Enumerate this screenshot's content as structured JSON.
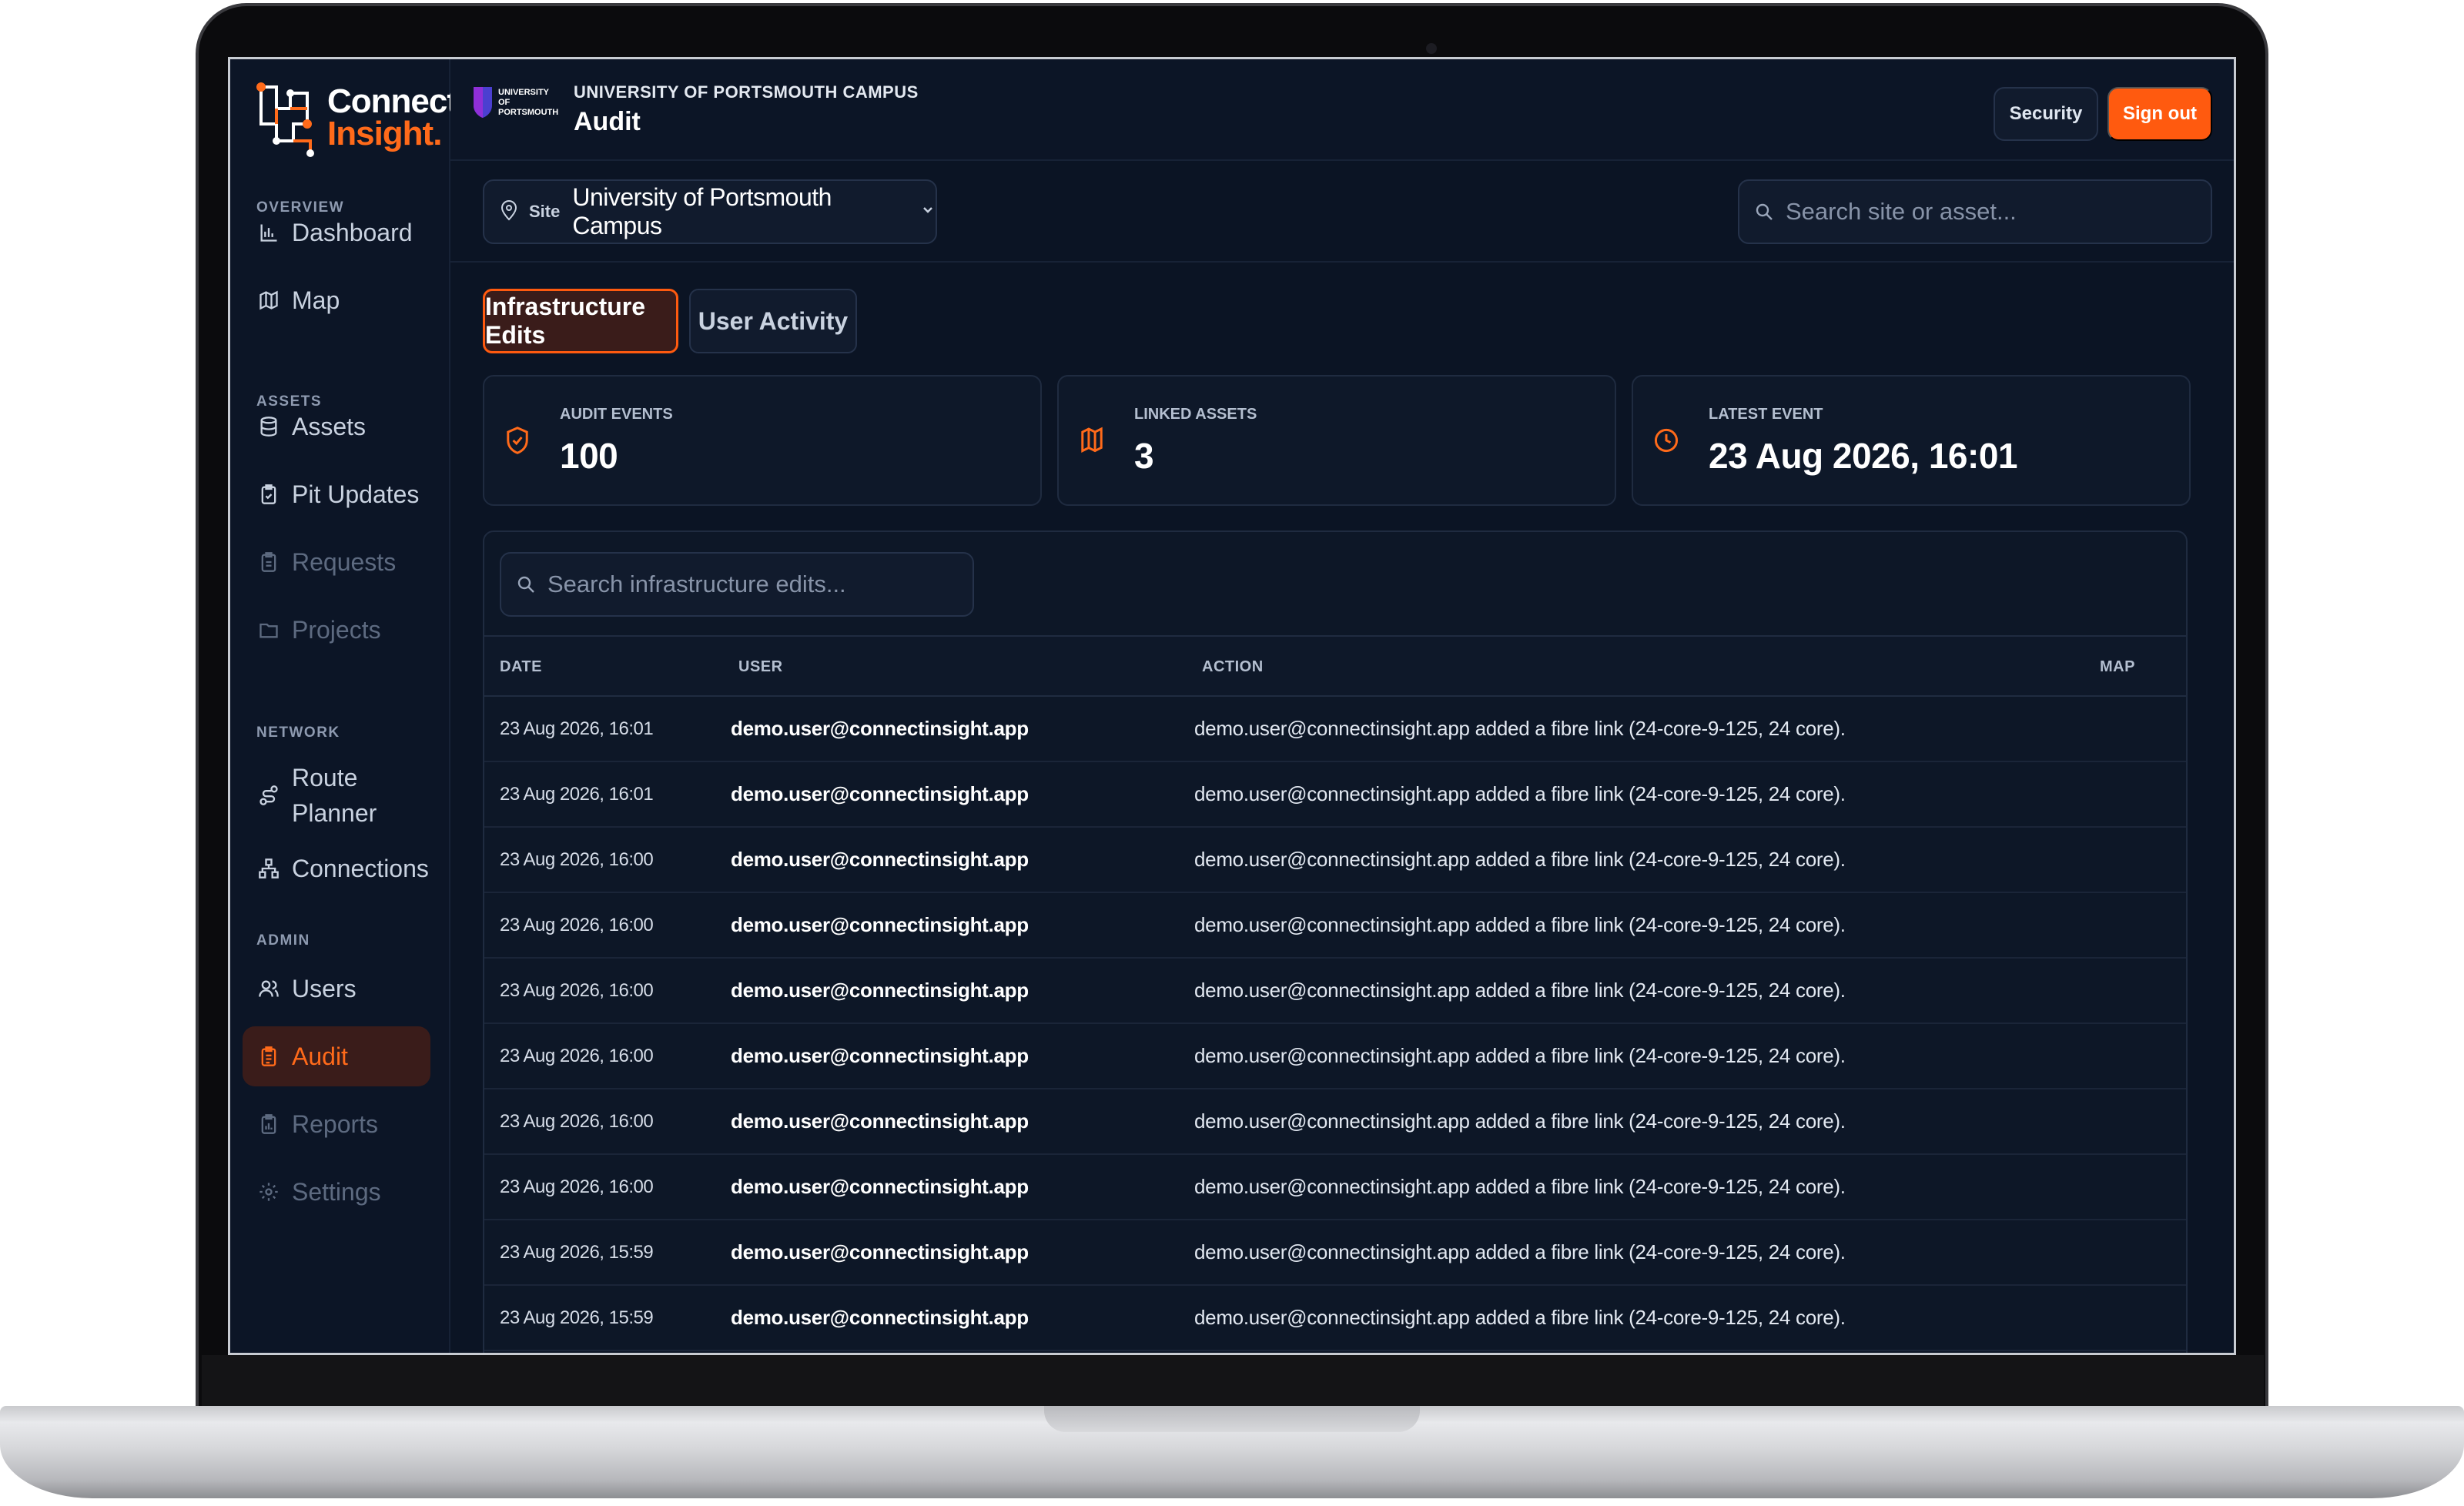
{
  "brand": {
    "line1": "Connect",
    "line2": "Insight.",
    "accent": "#ff5a0f"
  },
  "sidebar": {
    "sections": {
      "overview": "OVERVIEW",
      "assets": "ASSETS",
      "network": "NETWORK",
      "admin": "ADMIN"
    },
    "items": {
      "dashboard": "Dashboard",
      "map": "Map",
      "assets": "Assets",
      "pit_updates": "Pit Updates",
      "requests": "Requests",
      "projects": "Projects",
      "route_planner_1": "Route",
      "route_planner_2": "Planner",
      "connections": "Connections",
      "users": "Users",
      "audit": "Audit",
      "reports": "Reports",
      "settings": "Settings"
    },
    "active": "audit"
  },
  "header": {
    "org_logo_text": "UNIVERSITY OF PORTSMOUTH",
    "subtitle": "UNIVERSITY OF PORTSMOUTH CAMPUS",
    "title": "Audit",
    "security_label": "Security",
    "signout_label": "Sign out"
  },
  "sitebar": {
    "site_label": "Site",
    "site_value": "University of Portsmouth Campus",
    "search_placeholder": "Search site or asset..."
  },
  "tabs": {
    "infrastructure": "Infrastructure Edits",
    "user_activity": "User Activity",
    "active": "infrastructure"
  },
  "stats": {
    "audit_events": {
      "label": "AUDIT EVENTS",
      "value": "100",
      "icon": "shield-check-icon"
    },
    "linked_assets": {
      "label": "LINKED ASSETS",
      "value": "3",
      "icon": "map-icon"
    },
    "latest_event": {
      "label": "LATEST EVENT",
      "value": "23 Aug 2026, 16:01",
      "icon": "clock-icon"
    }
  },
  "table": {
    "search_placeholder": "Search infrastructure edits...",
    "columns": {
      "date": "DATE",
      "user": "USER",
      "action": "ACTION",
      "map": "MAP"
    },
    "rows": [
      {
        "date": "23 Aug 2026, 16:01",
        "user": "demo.user@connectinsight.app",
        "action": "demo.user@connectinsight.app added a fibre link (24-core-9-125, 24 core)."
      },
      {
        "date": "23 Aug 2026, 16:01",
        "user": "demo.user@connectinsight.app",
        "action": "demo.user@connectinsight.app added a fibre link (24-core-9-125, 24 core)."
      },
      {
        "date": "23 Aug 2026, 16:00",
        "user": "demo.user@connectinsight.app",
        "action": "demo.user@connectinsight.app added a fibre link (24-core-9-125, 24 core)."
      },
      {
        "date": "23 Aug 2026, 16:00",
        "user": "demo.user@connectinsight.app",
        "action": "demo.user@connectinsight.app added a fibre link (24-core-9-125, 24 core)."
      },
      {
        "date": "23 Aug 2026, 16:00",
        "user": "demo.user@connectinsight.app",
        "action": "demo.user@connectinsight.app added a fibre link (24-core-9-125, 24 core)."
      },
      {
        "date": "23 Aug 2026, 16:00",
        "user": "demo.user@connectinsight.app",
        "action": "demo.user@connectinsight.app added a fibre link (24-core-9-125, 24 core)."
      },
      {
        "date": "23 Aug 2026, 16:00",
        "user": "demo.user@connectinsight.app",
        "action": "demo.user@connectinsight.app added a fibre link (24-core-9-125, 24 core)."
      },
      {
        "date": "23 Aug 2026, 16:00",
        "user": "demo.user@connectinsight.app",
        "action": "demo.user@connectinsight.app added a fibre link (24-core-9-125, 24 core)."
      },
      {
        "date": "23 Aug 2026, 15:59",
        "user": "demo.user@connectinsight.app",
        "action": "demo.user@connectinsight.app added a fibre link (24-core-9-125, 24 core)."
      },
      {
        "date": "23 Aug 2026, 15:59",
        "user": "demo.user@connectinsight.app",
        "action": "demo.user@connectinsight.app added a fibre link (24-core-9-125, 24 core)."
      }
    ]
  }
}
